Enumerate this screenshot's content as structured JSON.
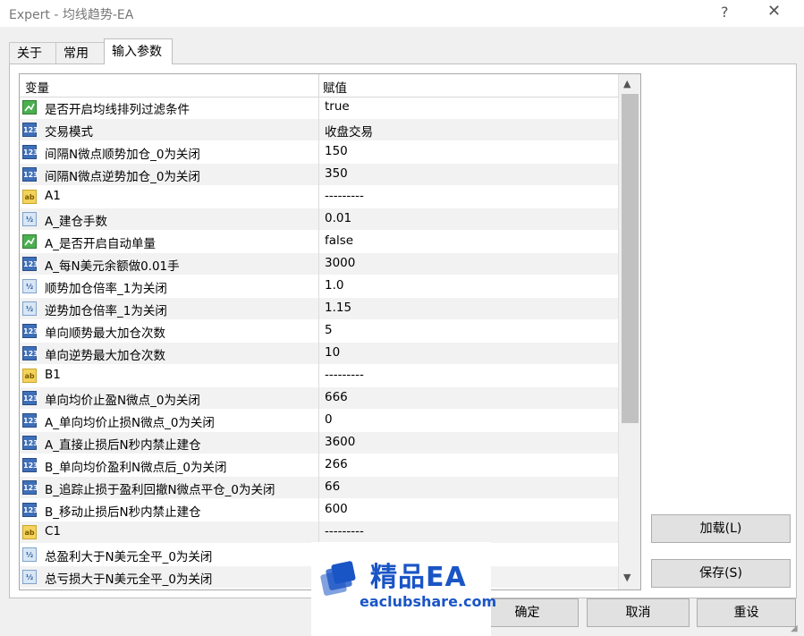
{
  "window": {
    "title": "Expert - 均线趋势-EA",
    "help": "?",
    "close": "✕"
  },
  "tabs": [
    {
      "label": "关于"
    },
    {
      "label": "常用"
    },
    {
      "label": "输入参数"
    }
  ],
  "table": {
    "col_variable": "变量",
    "col_value": "赋值",
    "rows": [
      {
        "type": "bool",
        "name": "是否开启均线排列过滤条件",
        "value": "true"
      },
      {
        "type": "int",
        "name": "交易模式",
        "value": "收盘交易"
      },
      {
        "type": "int",
        "name": "间隔N微点顺势加仓_0为关闭",
        "value": "150"
      },
      {
        "type": "int",
        "name": "间隔N微点逆势加仓_0为关闭",
        "value": "350"
      },
      {
        "type": "str",
        "name": "A1",
        "value": "---------"
      },
      {
        "type": "dbl",
        "name": "A_建仓手数",
        "value": "0.01"
      },
      {
        "type": "bool",
        "name": "A_是否开启自动单量",
        "value": "false"
      },
      {
        "type": "int",
        "name": "A_每N美元余额做0.01手",
        "value": "3000"
      },
      {
        "type": "dbl",
        "name": "顺势加仓倍率_1为关闭",
        "value": "1.0"
      },
      {
        "type": "dbl",
        "name": "逆势加仓倍率_1为关闭",
        "value": "1.15"
      },
      {
        "type": "int",
        "name": "单向顺势最大加仓次数",
        "value": "5"
      },
      {
        "type": "int",
        "name": "单向逆势最大加仓次数",
        "value": "10"
      },
      {
        "type": "str",
        "name": "B1",
        "value": "---------"
      },
      {
        "type": "int",
        "name": "单向均价止盈N微点_0为关闭",
        "value": "666"
      },
      {
        "type": "int",
        "name": "A_单向均价止损N微点_0为关闭",
        "value": "0"
      },
      {
        "type": "int",
        "name": "A_直接止损后N秒内禁止建仓",
        "value": "3600"
      },
      {
        "type": "int",
        "name": "B_单向均价盈利N微点后_0为关闭",
        "value": "266"
      },
      {
        "type": "int",
        "name": "B_追踪止损于盈利回撤N微点平仓_0为关闭",
        "value": "66"
      },
      {
        "type": "int",
        "name": "B_移动止损后N秒内禁止建仓",
        "value": "600"
      },
      {
        "type": "str",
        "name": "C1",
        "value": "---------"
      },
      {
        "type": "dbl",
        "name": "总盈利大于N美元全平_0为关闭",
        "value": ""
      },
      {
        "type": "dbl",
        "name": "总亏损大于N美元全平_0为关闭",
        "value": ""
      }
    ]
  },
  "icons": {
    "bool": "bool-icon",
    "int": "integer-icon",
    "dbl": "double-icon",
    "str": "string-icon"
  },
  "icon_text": {
    "int": "123",
    "dbl": "½",
    "str": "ab"
  },
  "buttons": {
    "load": "加载(L)",
    "save": "保存(S)",
    "ok": "确定",
    "cancel": "取消",
    "reset": "重设"
  },
  "watermark": {
    "brand": "精品EA",
    "site": "eaclubshare.com"
  },
  "colors": {
    "brand": "#1a55c6",
    "row_alt": "#f2f2f2",
    "scroll_thumb": "#c1c1c1"
  }
}
